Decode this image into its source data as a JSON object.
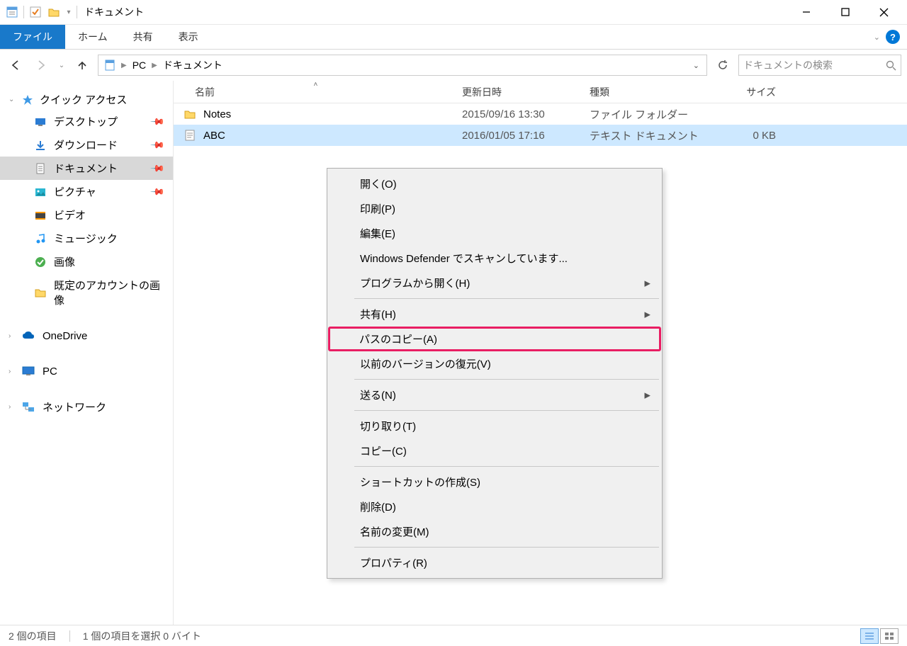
{
  "window": {
    "title": "ドキュメント"
  },
  "ribbon": {
    "file": "ファイル",
    "tabs": [
      "ホーム",
      "共有",
      "表示"
    ]
  },
  "breadcrumb": {
    "items": [
      "PC",
      "ドキュメント"
    ]
  },
  "search": {
    "placeholder": "ドキュメントの検索"
  },
  "sidebar": {
    "quick_access": "クイック アクセス",
    "items": [
      {
        "label": "デスクトップ",
        "icon": "desktop",
        "pinned": true
      },
      {
        "label": "ダウンロード",
        "icon": "download",
        "pinned": true
      },
      {
        "label": "ドキュメント",
        "icon": "document",
        "pinned": true,
        "active": true
      },
      {
        "label": "ピクチャ",
        "icon": "pictures",
        "pinned": true
      },
      {
        "label": "ビデオ",
        "icon": "video"
      },
      {
        "label": "ミュージック",
        "icon": "music"
      },
      {
        "label": "画像",
        "icon": "image-check"
      },
      {
        "label": "既定のアカウントの画像",
        "icon": "folder"
      }
    ],
    "onedrive": "OneDrive",
    "pc": "PC",
    "network": "ネットワーク"
  },
  "columns": {
    "name": "名前",
    "date": "更新日時",
    "type": "種類",
    "size": "サイズ"
  },
  "rows": [
    {
      "name": "Notes",
      "date": "2015/09/16 13:30",
      "type": "ファイル フォルダー",
      "size": "",
      "icon": "folder"
    },
    {
      "name": "ABC",
      "date": "2016/01/05 17:16",
      "type": "テキスト ドキュメント",
      "size": "0 KB",
      "icon": "text",
      "selected": true
    }
  ],
  "context_menu": {
    "groups": [
      [
        {
          "label": "開く(O)"
        },
        {
          "label": "印刷(P)"
        },
        {
          "label": "編集(E)"
        },
        {
          "label": "Windows Defender でスキャンしています..."
        },
        {
          "label": "プログラムから開く(H)",
          "submenu": true
        }
      ],
      [
        {
          "label": "共有(H)",
          "submenu": true
        },
        {
          "label": "パスのコピー(A)",
          "highlight": true
        },
        {
          "label": "以前のバージョンの復元(V)"
        }
      ],
      [
        {
          "label": "送る(N)",
          "submenu": true
        }
      ],
      [
        {
          "label": "切り取り(T)"
        },
        {
          "label": "コピー(C)"
        }
      ],
      [
        {
          "label": "ショートカットの作成(S)"
        },
        {
          "label": "削除(D)"
        },
        {
          "label": "名前の変更(M)"
        }
      ],
      [
        {
          "label": "プロパティ(R)"
        }
      ]
    ]
  },
  "statusbar": {
    "count": "2 個の項目",
    "selection": "1 個の項目を選択 0 バイト"
  }
}
